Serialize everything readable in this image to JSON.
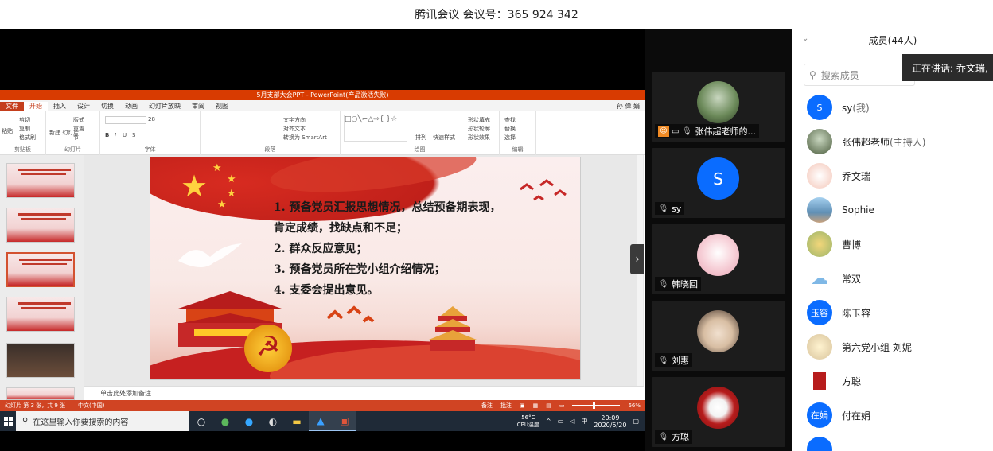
{
  "meeting": {
    "title": "腾讯会议 会议号：365 924 342"
  },
  "ppt": {
    "window_title": "5月支部大会PPT - PowerPoint(产品激活失败)",
    "user": "孙 偉 娟",
    "tabs": [
      "文件",
      "开始",
      "插入",
      "设计",
      "切换",
      "动画",
      "幻灯片放映",
      "审阅",
      "视图"
    ],
    "ribbon": {
      "clipboard": {
        "label": "剪贴板",
        "paste": "粘贴",
        "cut": "剪切",
        "copy": "复制",
        "format": "格式刷"
      },
      "slides": {
        "label": "幻灯片",
        "new": "新建\n幻灯片",
        "layout": "版式",
        "reset": "重置",
        "section": "节"
      },
      "font": {
        "label": "字体",
        "size": "28"
      },
      "paragraph": {
        "label": "段落",
        "text_dir": "文字方向",
        "align": "对齐文本",
        "smartart": "转换为 SmartArt"
      },
      "drawing": {
        "label": "绘图",
        "arrange": "排列",
        "quick_styles": "快速样式",
        "fill": "形状填充",
        "outline": "形状轮廓",
        "effects": "形状效果"
      },
      "editing": {
        "label": "编辑",
        "find": "查找",
        "replace": "替换",
        "select": "选择"
      }
    },
    "slide": {
      "items": [
        "1.  预备党员汇报思想情况，总结预备期表现，",
        "     肯定成绩，找缺点和不足；",
        "2.  群众反应意见；",
        "3.  预备党员所在党小组介绍情况；",
        "4.  支委会提出意见。"
      ]
    },
    "thumb_numbers": [
      "1",
      "2",
      "3",
      "4",
      "5",
      "6"
    ],
    "notes_placeholder": "单击此处添加备注",
    "status": {
      "slide_info": "幻灯片 第 3 张，共 9 张",
      "lang": "中文(中国)",
      "notes": "备注",
      "comments": "批注",
      "zoom": "66%"
    }
  },
  "taskbar": {
    "search": "在这里输入你要搜索的内容",
    "temp": "56°C",
    "cpu": "CPU温度",
    "ime": "中",
    "time": "20:09",
    "date": "2020/5/20"
  },
  "videos": [
    {
      "name": "张伟超老师的...",
      "type": "photo",
      "color": "#4a5b3c"
    },
    {
      "name": "sy",
      "type": "letter",
      "letter": "S",
      "color": "#0a6cff"
    },
    {
      "name": "韩晓回",
      "type": "photo",
      "color": "#f6c7cf"
    },
    {
      "name": "刘惠",
      "type": "photo",
      "color": "#d9c8b6"
    },
    {
      "name": "方聪",
      "type": "photo",
      "color": "#b71c1c"
    }
  ],
  "members": {
    "header": "成员(44人)",
    "search_placeholder": "搜索成员",
    "speaking": "正在讲话: 乔文瑞,",
    "list": [
      {
        "name": "sy",
        "tag": "(我)",
        "avatar_text": "S",
        "color": "#0a6cff"
      },
      {
        "name": "张伟超老师",
        "tag": "(主持人)",
        "avatar_text": "",
        "color": "#4a5b3c"
      },
      {
        "name": "乔文瑞",
        "tag": "",
        "avatar_text": "",
        "color": "#f4c6b8"
      },
      {
        "name": "Sophie",
        "tag": "",
        "avatar_text": "",
        "color": "#7fb3d5"
      },
      {
        "name": "曹博",
        "tag": "",
        "avatar_text": "",
        "color": "#9bb56a"
      },
      {
        "name": "常双",
        "tag": "",
        "avatar_text": "",
        "color": "#a9d2f0"
      },
      {
        "name": "陈玉容",
        "tag": "",
        "avatar_text": "玉容",
        "color": "#0a6cff"
      },
      {
        "name": "第六党小组 刘妮",
        "tag": "",
        "avatar_text": "",
        "color": "#e8d9b8"
      },
      {
        "name": "方聪",
        "tag": "",
        "avatar_text": "",
        "color": "#b71c1c"
      },
      {
        "name": "付在娟",
        "tag": "",
        "avatar_text": "在娟",
        "color": "#0a6cff"
      }
    ]
  }
}
